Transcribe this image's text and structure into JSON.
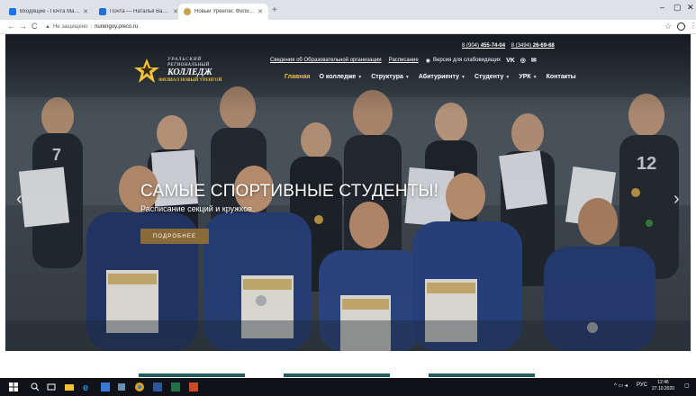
{
  "browser": {
    "tabs": [
      {
        "label": "Входящие - Почта Mail.ru",
        "icon": "mail-icon",
        "color": "#1a73e8",
        "active": false
      },
      {
        "label": "Почта — Наталья Васильевна",
        "icon": "mail-icon",
        "color": "#1e6fd9",
        "active": false
      },
      {
        "label": "Новый Уренгой. Филиал Урал",
        "icon": "college-icon",
        "color": "#c8a24a",
        "active": true
      }
    ],
    "new_tab": "+",
    "window_controls": {
      "minimize": "–",
      "maximize": "▢",
      "close": "✕"
    },
    "nav": {
      "back": "←",
      "forward": "→",
      "reload": "C"
    },
    "address": {
      "security_label": "Не защищено",
      "url": "nurengoy.preco.ru"
    }
  },
  "site": {
    "logo": {
      "line1": "УРАЛЬСКИЙ",
      "line2": "РЕГИОНАЛЬНЫЙ",
      "line3": "КОЛЛЕДЖ",
      "line4": "ФИЛИАЛ НОВЫЙ УРЕНГОЙ"
    },
    "phones": [
      {
        "prefix": "8 (904) ",
        "number": "455-74-04"
      },
      {
        "prefix": "8 (3494) ",
        "number": "26-69-68"
      }
    ],
    "info_links": [
      "Сведения об Образовательной организации",
      "Расписание"
    ],
    "accessibility_label": "Версия для слабовидящих",
    "social": [
      "VK",
      "◎",
      "✉"
    ],
    "nav": [
      {
        "label": "Главная",
        "active": true,
        "dropdown": false
      },
      {
        "label": "О колледже",
        "active": false,
        "dropdown": true
      },
      {
        "label": "Структура",
        "active": false,
        "dropdown": true
      },
      {
        "label": "Абитуриенту",
        "active": false,
        "dropdown": true
      },
      {
        "label": "Студенту",
        "active": false,
        "dropdown": true
      },
      {
        "label": "УРК",
        "active": false,
        "dropdown": true
      },
      {
        "label": "Контакты",
        "active": false,
        "dropdown": false
      }
    ],
    "hero": {
      "title": "САМЫЕ СПОРТИВНЫЕ СТУДЕНТЫ!",
      "subtitle": "Расписание секций и кружков.",
      "button": "ПОДРОБНЕЕ",
      "prev": "‹",
      "next": "›"
    }
  },
  "taskbar": {
    "tray_text": "РУС",
    "time": "12:46",
    "date": "27.10.2020"
  },
  "colors": {
    "accent_gold": "#f5c23a",
    "button_brown": "#8b6a3a",
    "teal_strip": "#1e5f5c"
  }
}
